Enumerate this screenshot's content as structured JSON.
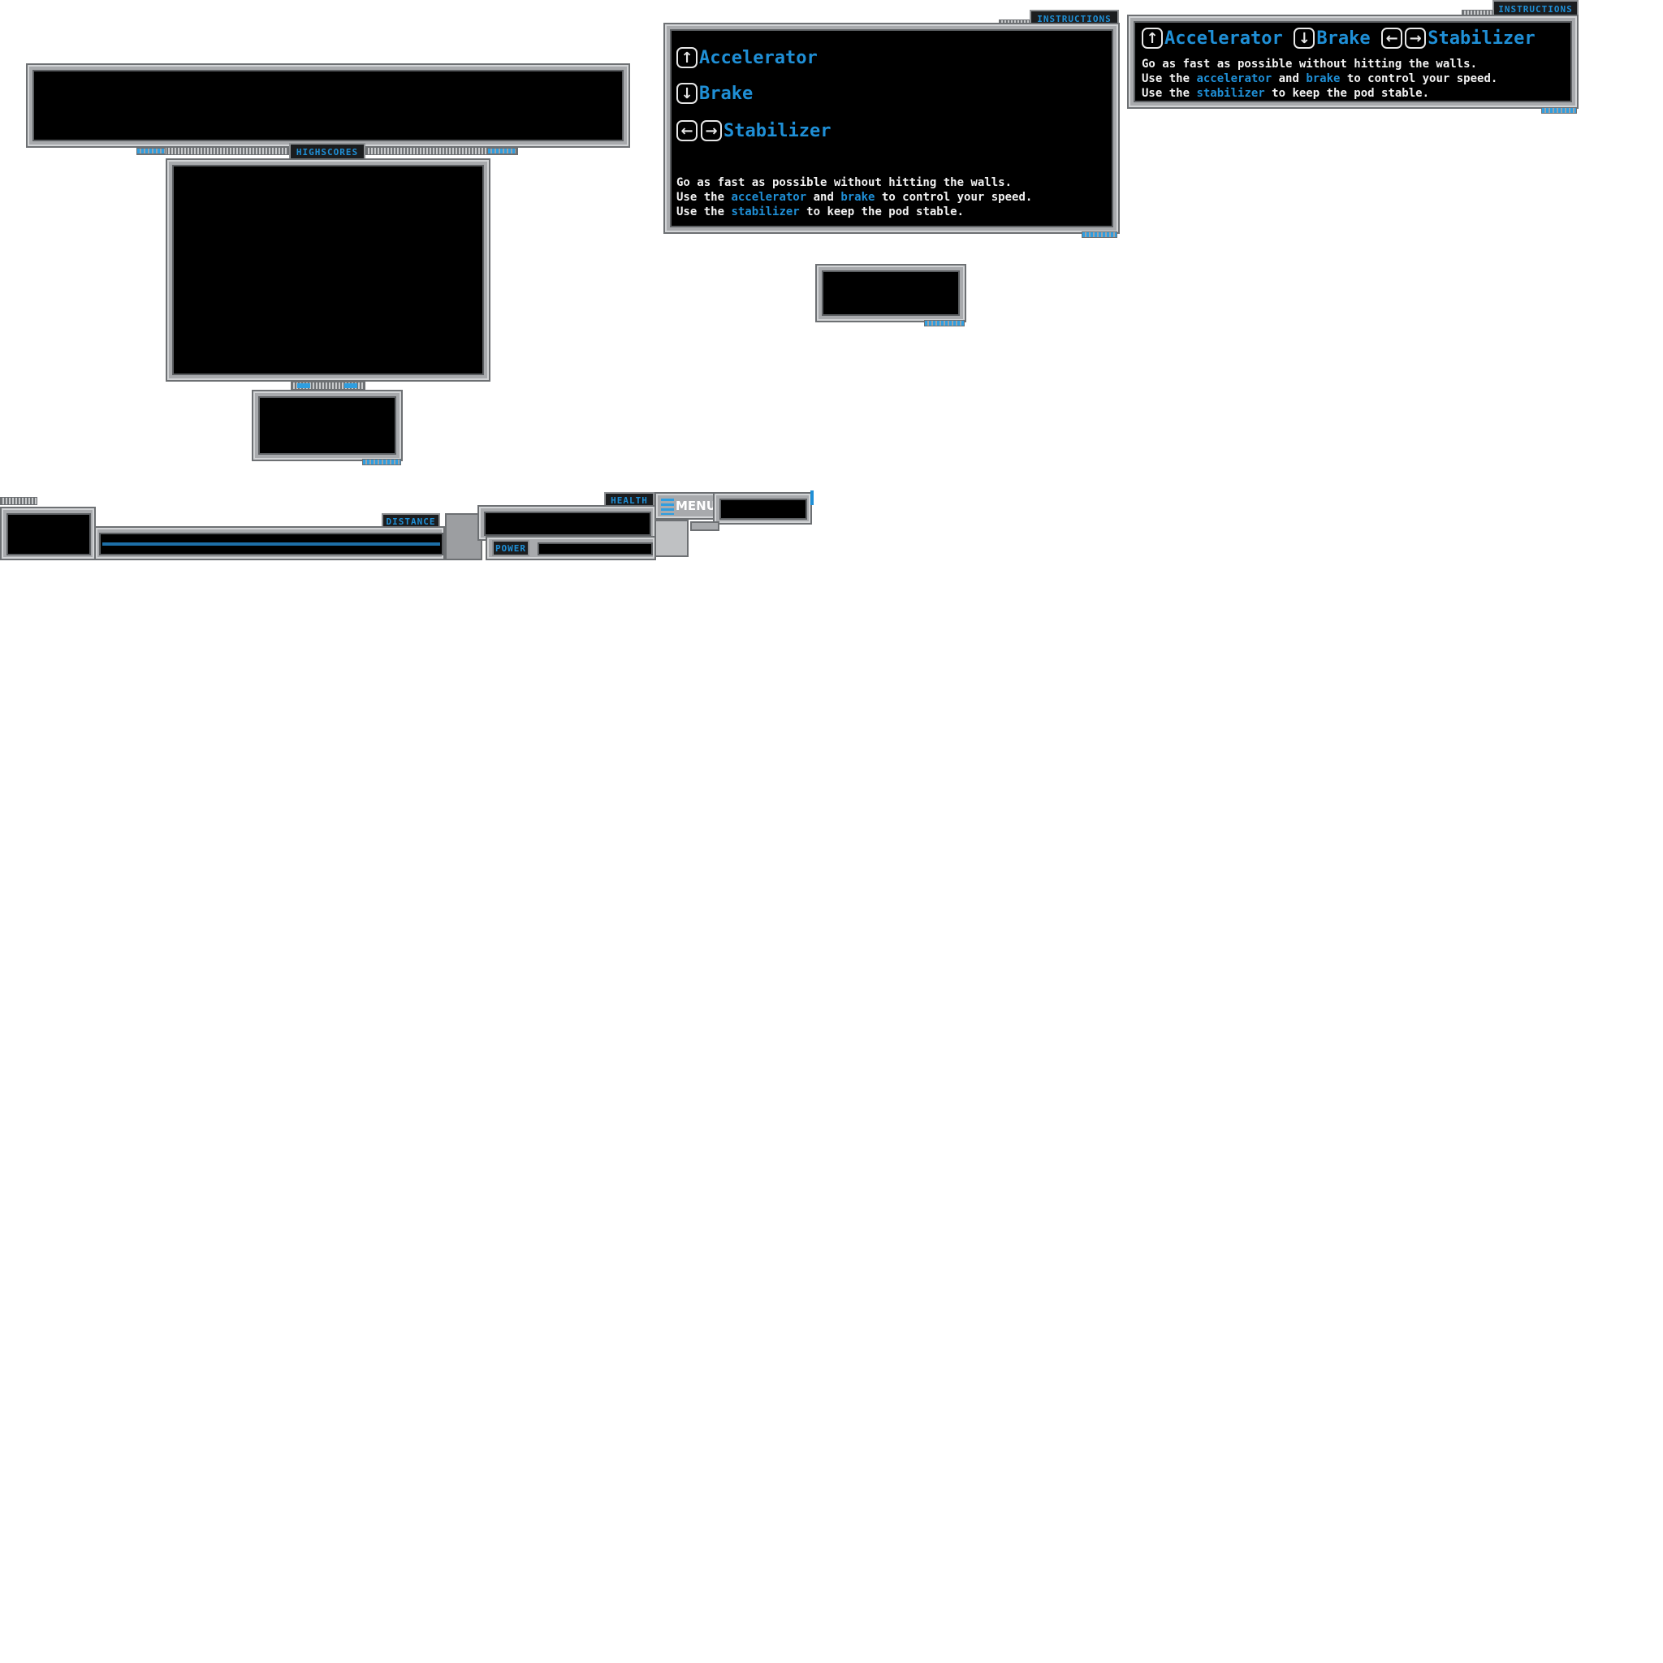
{
  "highscores_panel": {
    "tab_label": "HIGHSCORES"
  },
  "instructions_large": {
    "tab_label": "INSTRUCTIONS",
    "keys": [
      {
        "icons": [
          "up-arrow-icon"
        ],
        "label": "Accelerator"
      },
      {
        "icons": [
          "down-arrow-icon"
        ],
        "label": "Brake"
      },
      {
        "icons": [
          "left-arrow-icon",
          "right-arrow-icon"
        ],
        "label": "Stabilizer"
      }
    ],
    "lines": [
      {
        "parts": [
          "Go as fast as possible without hitting the walls."
        ]
      },
      {
        "pre": "Use the ",
        "kw1": "accelerator",
        "mid": " and ",
        "kw2": "brake",
        "post": " to control your speed."
      },
      {
        "pre": "Use the ",
        "kw1": "stabilizer",
        "post": " to keep the pod stable."
      }
    ]
  },
  "instructions_compact": {
    "tab_label": "INSTRUCTIONS",
    "accelerator": "Accelerator",
    "brake": "Brake",
    "stabilizer": "Stabilizer",
    "line1": "Go as fast as possible without hitting the walls.",
    "line2_pre": "Use the ",
    "line2_kw1": "accelerator",
    "line2_mid": " and ",
    "line2_kw2": "brake",
    "line2_post": " to control your speed.",
    "line3_pre": "Use the ",
    "line3_kw1": "stabilizer",
    "line3_post": " to keep the pod stable."
  },
  "hud": {
    "distance_label": "DISTANCE",
    "health_label": "HEALTH",
    "power_label": "POWER",
    "menu_label": "MENU"
  },
  "colors": {
    "accent": "#1f8fd6",
    "frame": "#a8aaad",
    "screen": "#000000"
  }
}
